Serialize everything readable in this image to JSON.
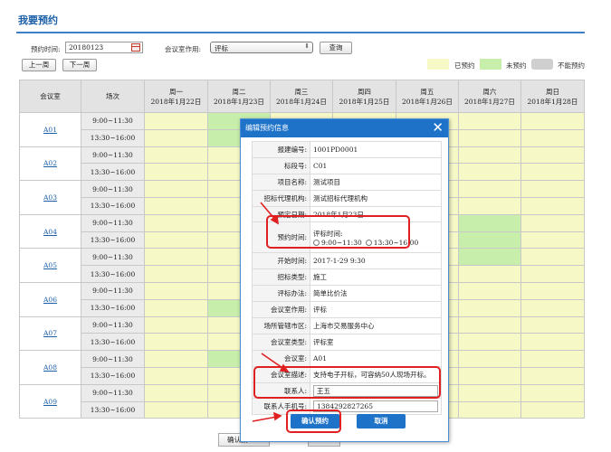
{
  "page": {
    "title": "我要预约"
  },
  "filters": {
    "date_label": "预约时间:",
    "date_value": "20180123",
    "room_use_label": "会议室作用:",
    "room_use_value": "评标",
    "query_label": "查询",
    "prev_week_label": "上一周",
    "next_week_label": "下一周"
  },
  "legend": [
    {
      "label": "已预约",
      "color": "#f6f8c6"
    },
    {
      "label": "未预约",
      "color": "#c8eeac"
    },
    {
      "label": "不能预约",
      "color": "#cfcfcf"
    }
  ],
  "grid": {
    "col_room": "会议室",
    "col_slot": "场次",
    "days": [
      {
        "name": "周一",
        "date": "2018年1月22日"
      },
      {
        "name": "周二",
        "date": "2018年1月23日"
      },
      {
        "name": "周三",
        "date": "2018年1月24日"
      },
      {
        "name": "周四",
        "date": "2018年1月25日"
      },
      {
        "name": "周五",
        "date": "2018年1月26日"
      },
      {
        "name": "周六",
        "date": "2018年1月27日"
      },
      {
        "name": "周日",
        "date": "2018年1月28日"
      }
    ],
    "slots": [
      "9:00~11:30",
      "13:30~16:00"
    ],
    "rooms": [
      "A01",
      "A02",
      "A03",
      "A04",
      "A05",
      "A06",
      "A07",
      "A08",
      "A09"
    ]
  },
  "dialog": {
    "title": "编辑预约信息",
    "fields": [
      {
        "key": "报建编号:",
        "value": "1001PD0001"
      },
      {
        "key": "标段号:",
        "value": "C01"
      },
      {
        "key": "项目名称:",
        "value": "测试项目"
      },
      {
        "key": "招标代理机构:",
        "value": "测试招标代理机构"
      },
      {
        "key": "预定日期:",
        "value": "2018年1月23日"
      },
      {
        "key": "预约时间:",
        "value": "评标时间:"
      },
      {
        "key": "开始时间:",
        "value": "2017-1-29 9:30"
      },
      {
        "key": "招标类型:",
        "value": "施工"
      },
      {
        "key": "评标办法:",
        "value": "简单比价法"
      },
      {
        "key": "会议室作用:",
        "value": "评标"
      },
      {
        "key": "场所管辖市区:",
        "value": "上海市交易服务中心"
      },
      {
        "key": "会议室类型:",
        "value": "评标室"
      },
      {
        "key": "会议室:",
        "value": "A01"
      },
      {
        "key": "会议室描述:",
        "value": "支持电子开标，可容纳50人现场开标。"
      },
      {
        "key": "联系人:",
        "value": "王五"
      },
      {
        "key": "联系人手机号:",
        "value": "13842928272​65"
      }
    ],
    "time_options": [
      "9:00~11:30",
      "13:30~16:00"
    ],
    "confirm_label": "确认预约",
    "cancel_label": "取消"
  },
  "bottom": {
    "confirm_label": "确认预"
  }
}
